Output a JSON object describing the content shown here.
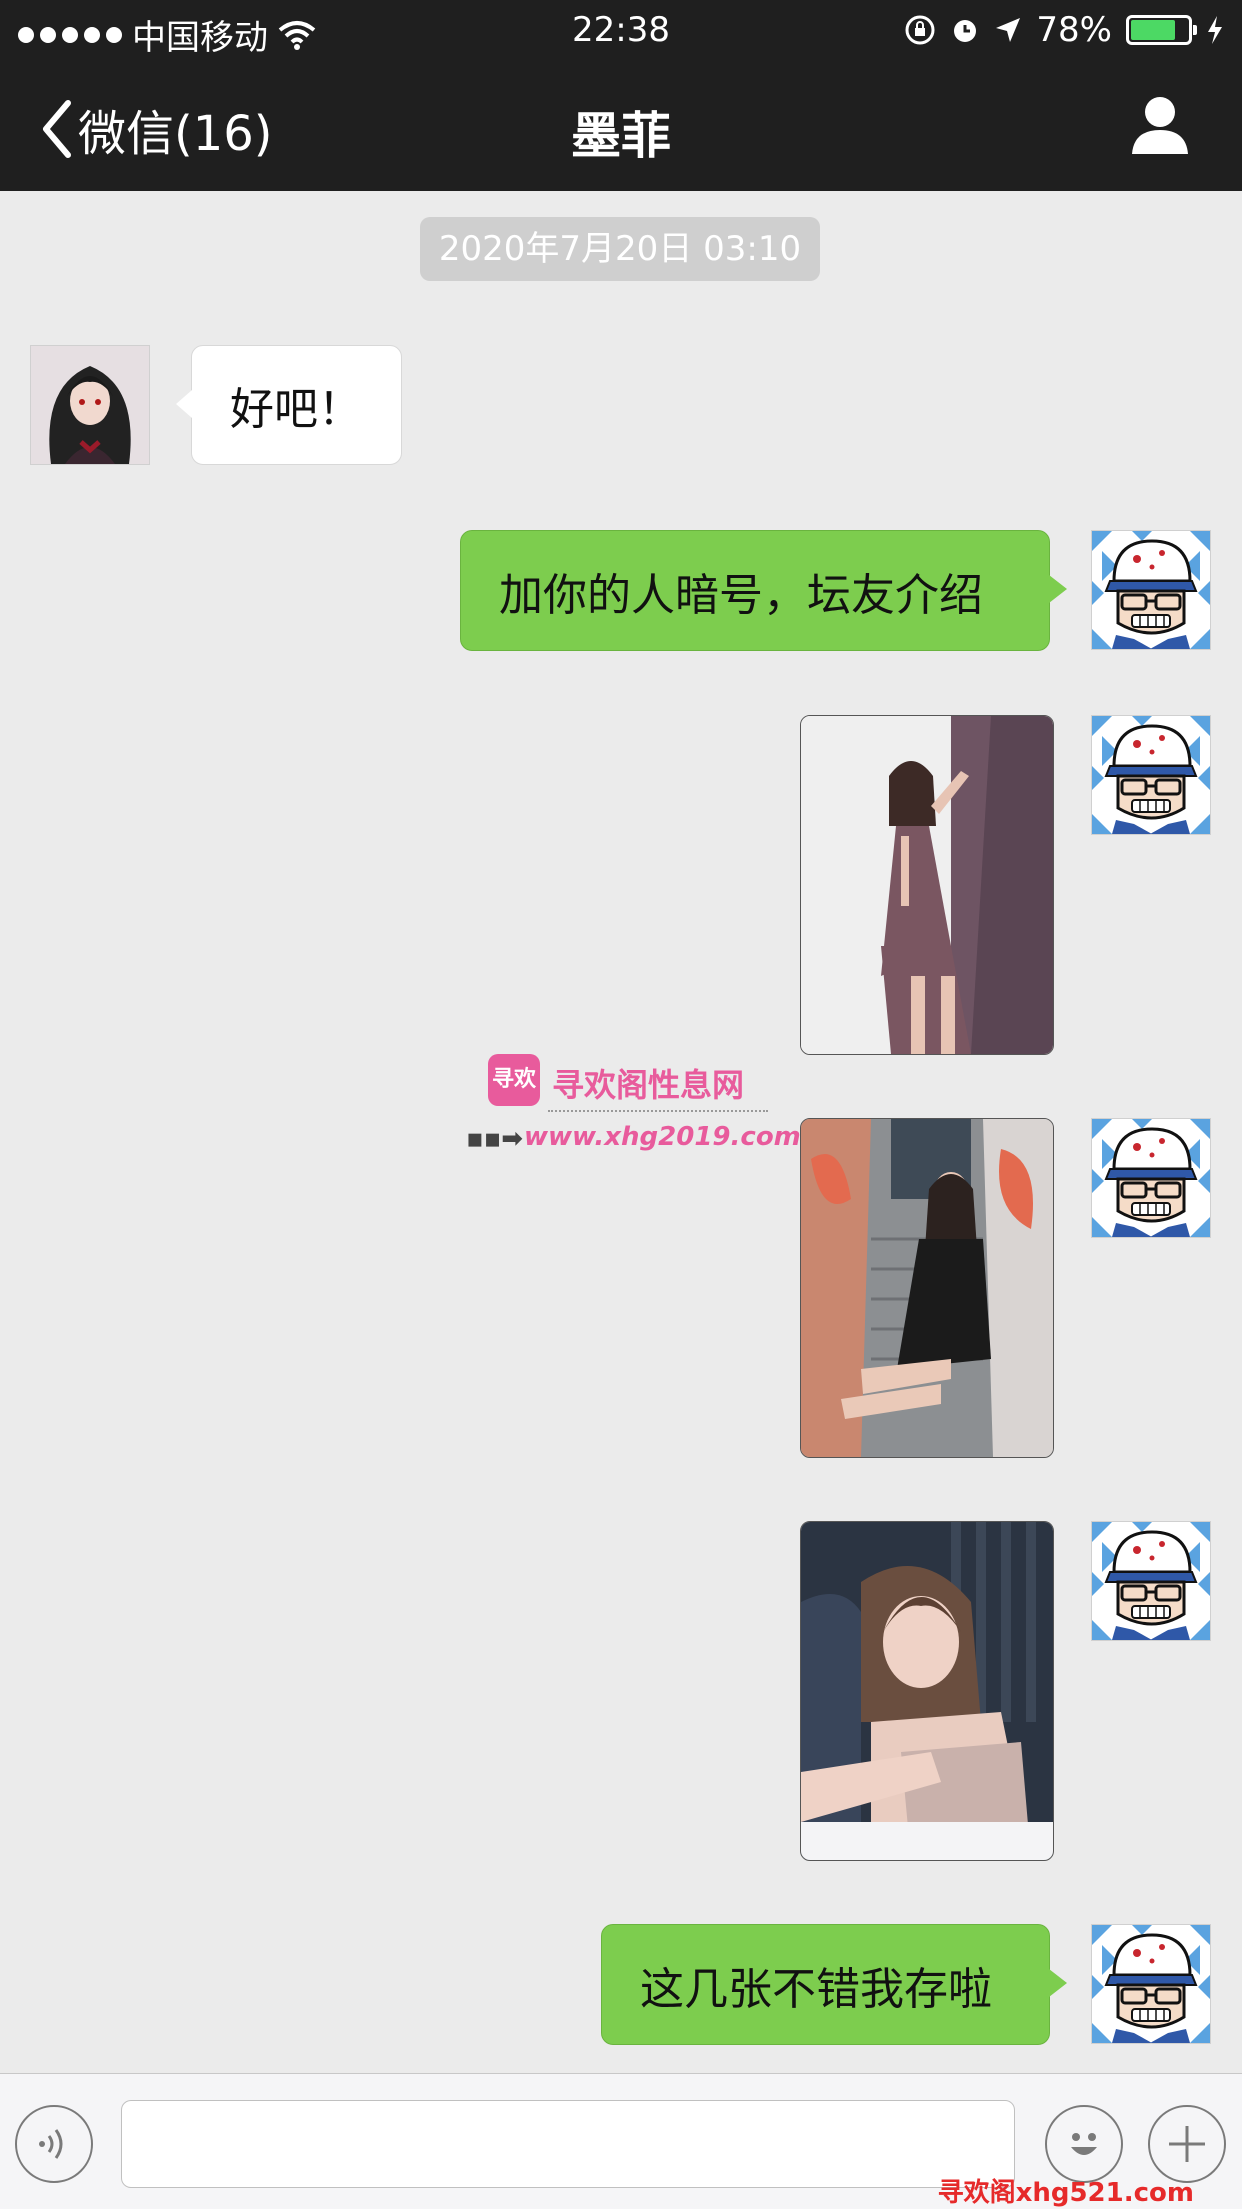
{
  "status_bar": {
    "carrier": "中国移动",
    "time": "22:38",
    "battery": "78%",
    "battery_level": 0.78
  },
  "nav": {
    "back_label": "微信(16)",
    "title": "墨菲"
  },
  "chat": {
    "timestamp": "2020年7月20日 03:10",
    "messages": [
      {
        "side": "left",
        "type": "text",
        "text": "好吧！"
      },
      {
        "side": "right",
        "type": "text",
        "text": "加你的人暗号，坛友介绍"
      },
      {
        "side": "right",
        "type": "image",
        "text": ""
      },
      {
        "side": "right",
        "type": "image",
        "text": ""
      },
      {
        "side": "right",
        "type": "image",
        "text": ""
      },
      {
        "side": "right",
        "type": "text",
        "text": "这几张不错我存啦"
      }
    ]
  },
  "watermark": {
    "logo_text": "寻欢",
    "title": "寻欢阁性息网",
    "url": "www.xhg2019.com",
    "footer": "寻欢阁xhg521.com"
  },
  "input_bar": {
    "value": "",
    "placeholder": ""
  },
  "colors": {
    "bar_bg": "#1f1f1f",
    "chat_bg": "#ebebeb",
    "bubble_green": "#7dcd4e",
    "bubble_white": "#ffffff",
    "battery_green": "#4cd964",
    "watermark_pink": "#e85b9c"
  }
}
